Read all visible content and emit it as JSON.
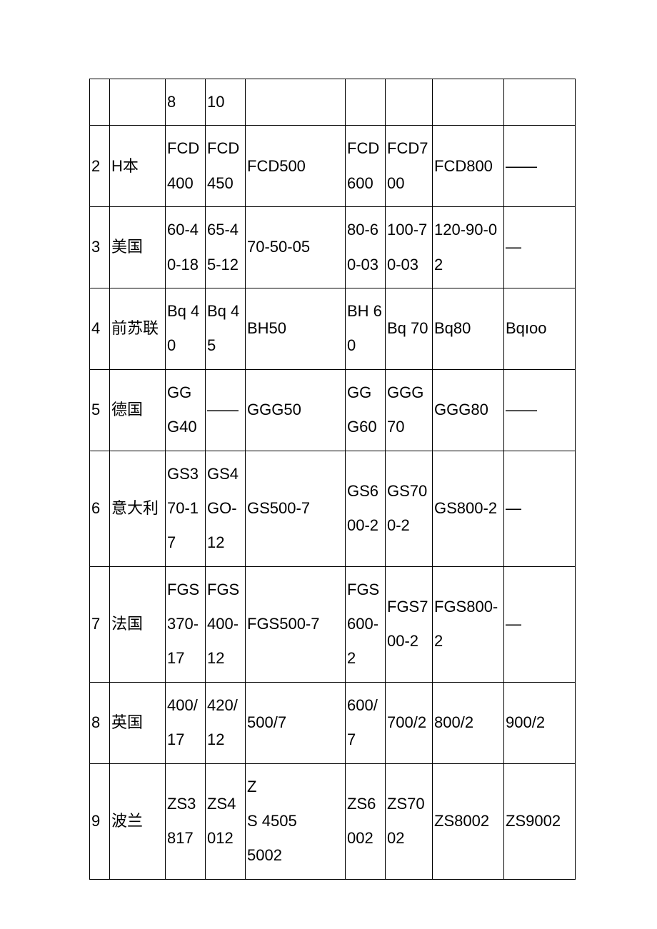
{
  "table": {
    "rows": [
      {
        "c0": "",
        "c1": "",
        "c2": "8",
        "c3": "10",
        "c4": "",
        "c5": "",
        "c6": "",
        "c7": "",
        "c8": ""
      },
      {
        "c0": "2",
        "c1": "H本",
        "c2": "FCD400",
        "c3": "FCD450",
        "c4": "FCD500",
        "c5": "FCD600",
        "c6": "FCD700",
        "c7": "FCD800",
        "c8": "——"
      },
      {
        "c0": "3",
        "c1": "美国",
        "c2": "60-40-18",
        "c3": "65-45-12",
        "c4": "70-50-05",
        "c5": "80-60-03",
        "c6": "100-70-03",
        "c7": "120-90-02",
        "c8": "—"
      },
      {
        "c0": "4",
        "c1": "前苏联",
        "c2": "Bq 40",
        "c3": "Bq 45",
        "c4": "BH50",
        "c5": "BH 60",
        "c6": "Bq 70",
        "c7": "Bq80",
        "c8": "Bqıoo"
      },
      {
        "c0": "5",
        "c1": "德国",
        "c2": "GGG40",
        "c3": "——",
        "c4": "GGG50",
        "c5": "GGG60",
        "c6": "GGG70",
        "c7": "GGG80",
        "c8": "——"
      },
      {
        "c0": "6",
        "c1": "意大利",
        "c2": "GS370-17",
        "c3": "GS4GO-12",
        "c4": "GS500-7",
        "c5": "GS600-2",
        "c6": "GS700-2",
        "c7": "GS800-2",
        "c8": "—"
      },
      {
        "c0": "7",
        "c1": "法国",
        "c2": "FGS370-17",
        "c3": "FGS400-12",
        "c4": "FGS500-7",
        "c5": "FGS600-2",
        "c6": "FGS700-2",
        "c7": "FGS800-2",
        "c8": "—"
      },
      {
        "c0": "8",
        "c1": "英国",
        "c2": "400/17",
        "c3": "420/12",
        "c4": "500/7",
        "c5": "600/7",
        "c6": "700/2",
        "c7": "800/2",
        "c8": "900/2"
      },
      {
        "c0": "9",
        "c1": "波兰",
        "c2": "ZS3817",
        "c3": "ZS4012",
        "c4": "Z\nS   4505\n     5002",
        "c5": "ZS6002",
        "c6": "ZS7002",
        "c7": "ZS8002",
        "c8": "ZS9002"
      }
    ]
  }
}
